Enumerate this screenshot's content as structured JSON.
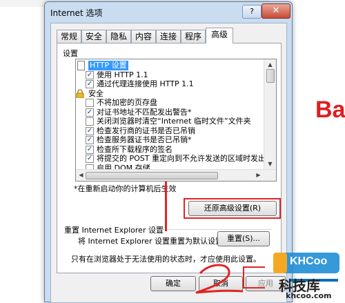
{
  "background": {
    "brand_text": "Ba"
  },
  "dialog": {
    "title": "Internet 选项",
    "help_label": "?",
    "close_label": "✕",
    "tabs": [
      {
        "label": "常规"
      },
      {
        "label": "安全"
      },
      {
        "label": "隐私"
      },
      {
        "label": "内容"
      },
      {
        "label": "连接"
      },
      {
        "label": "程序"
      },
      {
        "label": "高级"
      }
    ],
    "active_tab": "高级",
    "settings_label": "设置",
    "settings_items": [
      {
        "type": "header-doc",
        "label": "HTTP 设置"
      },
      {
        "type": "check",
        "checked": true,
        "label": "使用 HTTP 1.1"
      },
      {
        "type": "check",
        "checked": true,
        "label": "通过代理连接使用 HTTP 1.1"
      },
      {
        "type": "header-lock",
        "label": "安全"
      },
      {
        "type": "check",
        "checked": false,
        "label": "不将加密的页存盘"
      },
      {
        "type": "check",
        "checked": true,
        "label": "对证书地址不匹配发出警告*"
      },
      {
        "type": "check",
        "checked": false,
        "label": "关闭浏览器时清空“Internet 临时文件”文件夹"
      },
      {
        "type": "check",
        "checked": true,
        "label": "检查发行商的证书是否已吊销"
      },
      {
        "type": "check",
        "checked": true,
        "label": "检查服务器证书是否已吊销*"
      },
      {
        "type": "check",
        "checked": true,
        "label": "检查所下载程序的签名"
      },
      {
        "type": "check",
        "checked": true,
        "label": "将提交的 POST 重定向到不允许发送的区域时发出警"
      },
      {
        "type": "check",
        "checked": false,
        "label": "启用 DOM 存储"
      }
    ],
    "restart_note": "*在重新启动你的计算机后生效",
    "restore_button": "还原高级设置(R)",
    "reset_group": {
      "title": "重置 Internet Explorer 设置",
      "description": "将 Internet Explorer 设置重置为默认设置。",
      "button": "重置(S)...",
      "note": "只有在浏览器处于无法使用的状态时，才应使用此设置。"
    },
    "footer": {
      "ok": "确定",
      "cancel": "取消",
      "apply": "应用"
    }
  },
  "annotation": {
    "number": "2"
  },
  "watermark": {
    "logo_text": "KHCoo",
    "site_name": "科技库",
    "url": "khcoo.com"
  }
}
